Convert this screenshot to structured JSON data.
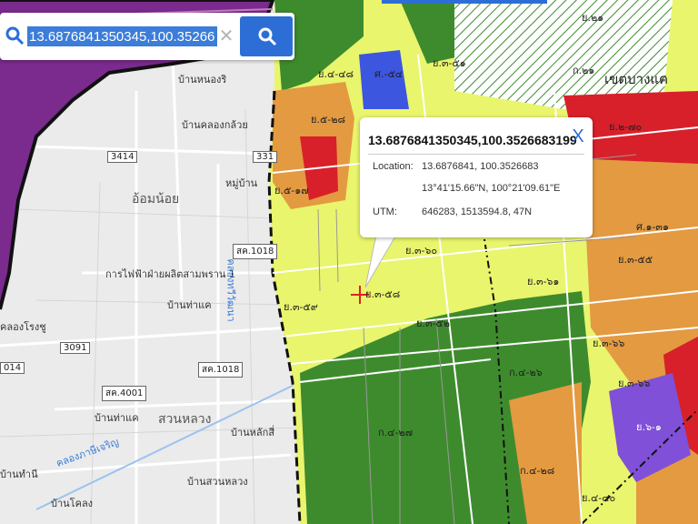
{
  "search": {
    "value": "13.6876841350345,100.3526683199",
    "clear_glyph": "✕"
  },
  "popup": {
    "title": "13.6876841350345,100.3526683199",
    "close_glyph": "X",
    "location_label": "Location:",
    "location_decimal": "13.6876841, 100.3526683",
    "location_dms": "13°41'15.66\"N, 100°21'09.61\"E",
    "utm_label": "UTM:",
    "utm_value": "646283, 1513594.8, 47N"
  },
  "map_labels": {
    "ban_nong_ri": "บ้านหนองริ",
    "ban_nong_khlong": "บ้านคลองกล้วย",
    "om_noi": "อ้อมน้อย",
    "thai_banhan": "หมู่บ้าน",
    "power_office": "การไฟฟ้าฝ่ายผลิตสามพราน 1",
    "ban_thang_khwang": "บ้านท่าแค",
    "khlong_rong_chu": "คลองโรงชู",
    "ban_thamae": "บ้านท่าแค",
    "suan_luang": "สวนหลวง",
    "ban_lak_si": "บ้านหลักสี่",
    "ban_thanai": "บ้านทำนี",
    "ban_suan_luang": "บ้านสวนหลวง",
    "ban_khlong": "บ้านโคลง",
    "khet_bang_khae": "เขตบางแค",
    "khlong_phasi": "คลองภาษีเจริญ",
    "khlong_thawiwatthana": "คลองทวีวัฒนา"
  },
  "road_shields": {
    "r3414": "3414",
    "r331": "331",
    "sk1018a": "สค.1018",
    "r3091": "3091",
    "r014": "014",
    "sk1018b": "สค.1018",
    "sk4001": "สค.4001"
  },
  "zone_codes": {
    "z1": "ย.๔-๔๘",
    "z2": "ศ.-๕๔",
    "z3": "ย.๓-๕๑",
    "z4": "ย.๕-๒๘",
    "z5": "ย.๕-๑๗",
    "z6": "ย.๓-๖๐",
    "z7": "ย.๓-๕๘",
    "z8": "ย.๓-๕๙",
    "z9": "ย.๓-๕๒",
    "z10": "ก.๔-๒๖",
    "z11": "ก.๔-๒๗",
    "z12": "ก.๔-๒๘",
    "z13": "ย.๓-๖๖",
    "z14": "ย.๓-๕๕",
    "z15": "ศ.๑-๓๑",
    "z16": "ย.๒-๗๐",
    "z17": "ก.๒๑",
    "z18": "ย.๓-๖๑",
    "z19": "ย.๓-๖๖",
    "z20": "ย.๖-๑",
    "z21": "ย.๔-๔๐",
    "z22": "ย.๒๑"
  },
  "colors": {
    "base_map": "#ebebeb",
    "purple_zone": "#7b2a8e",
    "dark_green": "#3e8b2e",
    "light_yellow": "#e9f56c",
    "orange": "#e39a41",
    "red": "#d8202a",
    "blue": "#3d56e0",
    "violet": "#8050d8",
    "accent": "#2c6ed5",
    "marker": "#e02020"
  }
}
